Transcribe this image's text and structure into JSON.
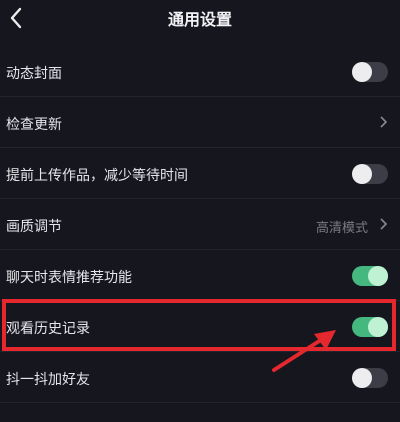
{
  "header": {
    "title": "通用设置",
    "back_icon": "chevron-left-icon"
  },
  "settings": [
    {
      "label": "动态封面",
      "control": "toggle",
      "on": false
    },
    {
      "label": "检查更新",
      "control": "chevron"
    },
    {
      "label": "提前上传作品，减少等待时间",
      "control": "toggle",
      "on": false
    },
    {
      "label": "画质调节",
      "control": "value-chevron",
      "value": "高清模式"
    },
    {
      "label": "聊天时表情推荐功能",
      "control": "toggle",
      "on": true
    },
    {
      "label": "观看历史记录",
      "control": "toggle",
      "on": true
    },
    {
      "label": "抖一抖加好友",
      "control": "toggle",
      "on": false
    }
  ],
  "colors": {
    "background": "#16161f",
    "toggle_on": "#45b880",
    "toggle_off": "#3d3d48",
    "annotation": "#e5282e"
  }
}
